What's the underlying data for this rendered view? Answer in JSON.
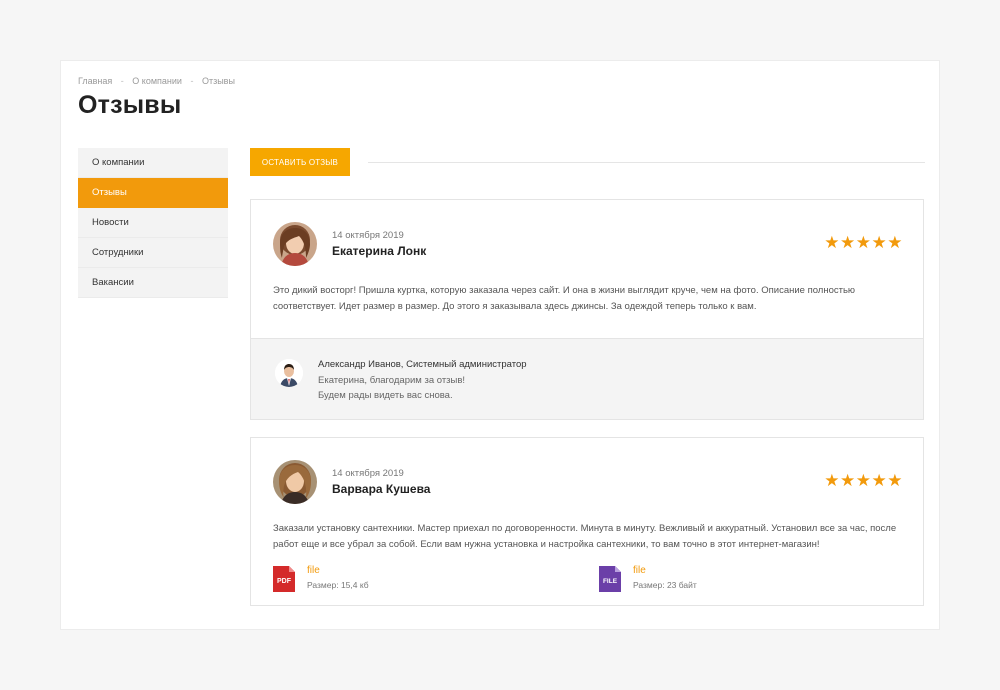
{
  "breadcrumb": {
    "items": [
      "Главная",
      "О компании",
      "Отзывы"
    ],
    "separator": "-"
  },
  "page": {
    "title": "Отзывы"
  },
  "sidebar": {
    "items": [
      {
        "label": "О компании"
      },
      {
        "label": "Отзывы",
        "active": true
      },
      {
        "label": "Новости"
      },
      {
        "label": "Сотрудники"
      },
      {
        "label": "Вакансии"
      }
    ]
  },
  "actions": {
    "leave_review": "ОСТАВИТЬ ОТЗЫВ"
  },
  "colors": {
    "accent": "#f29a0c",
    "button": "#f6a700",
    "pdf": "#d42a2a",
    "file": "#6b3fa8"
  },
  "reviews": [
    {
      "date": "14 октября 2019",
      "author": "Екатерина Лонк",
      "rating": 5,
      "stars": "★★★★★",
      "text": "Это дикий восторг! Пришла куртка, которую заказала через сайт. И она в жизни выглядит круче, чем на фото. Описание полностью соответствует. Идет размер в размер. До этого я заказывала здесь джинсы. За одеждой теперь только к вам.",
      "reply": {
        "author": "Александр Иванов, Системный администратор",
        "line1": "Екатерина, благодарим за отзыв!",
        "line2": "Будем рады видеть вас снова."
      }
    },
    {
      "date": "14 октября 2019",
      "author": "Варвара Кушева",
      "rating": 5,
      "stars": "★★★★★",
      "text": "Заказали установку сантехники. Мастер приехал по договоренности. Минута в минуту. Вежливый и аккуратный. Установил все за час, после работ еще и все убрал за собой. Если вам нужна установка и настройка сантехники, то вам точно в этот интернет-магазин!",
      "files": [
        {
          "label": "file",
          "size": "Размер: 15,4 кб",
          "type": "PDF",
          "icon": "pdf-file-icon"
        },
        {
          "label": "file",
          "size": "Размер: 23 байт",
          "type": "FILE",
          "icon": "generic-file-icon"
        }
      ]
    }
  ]
}
